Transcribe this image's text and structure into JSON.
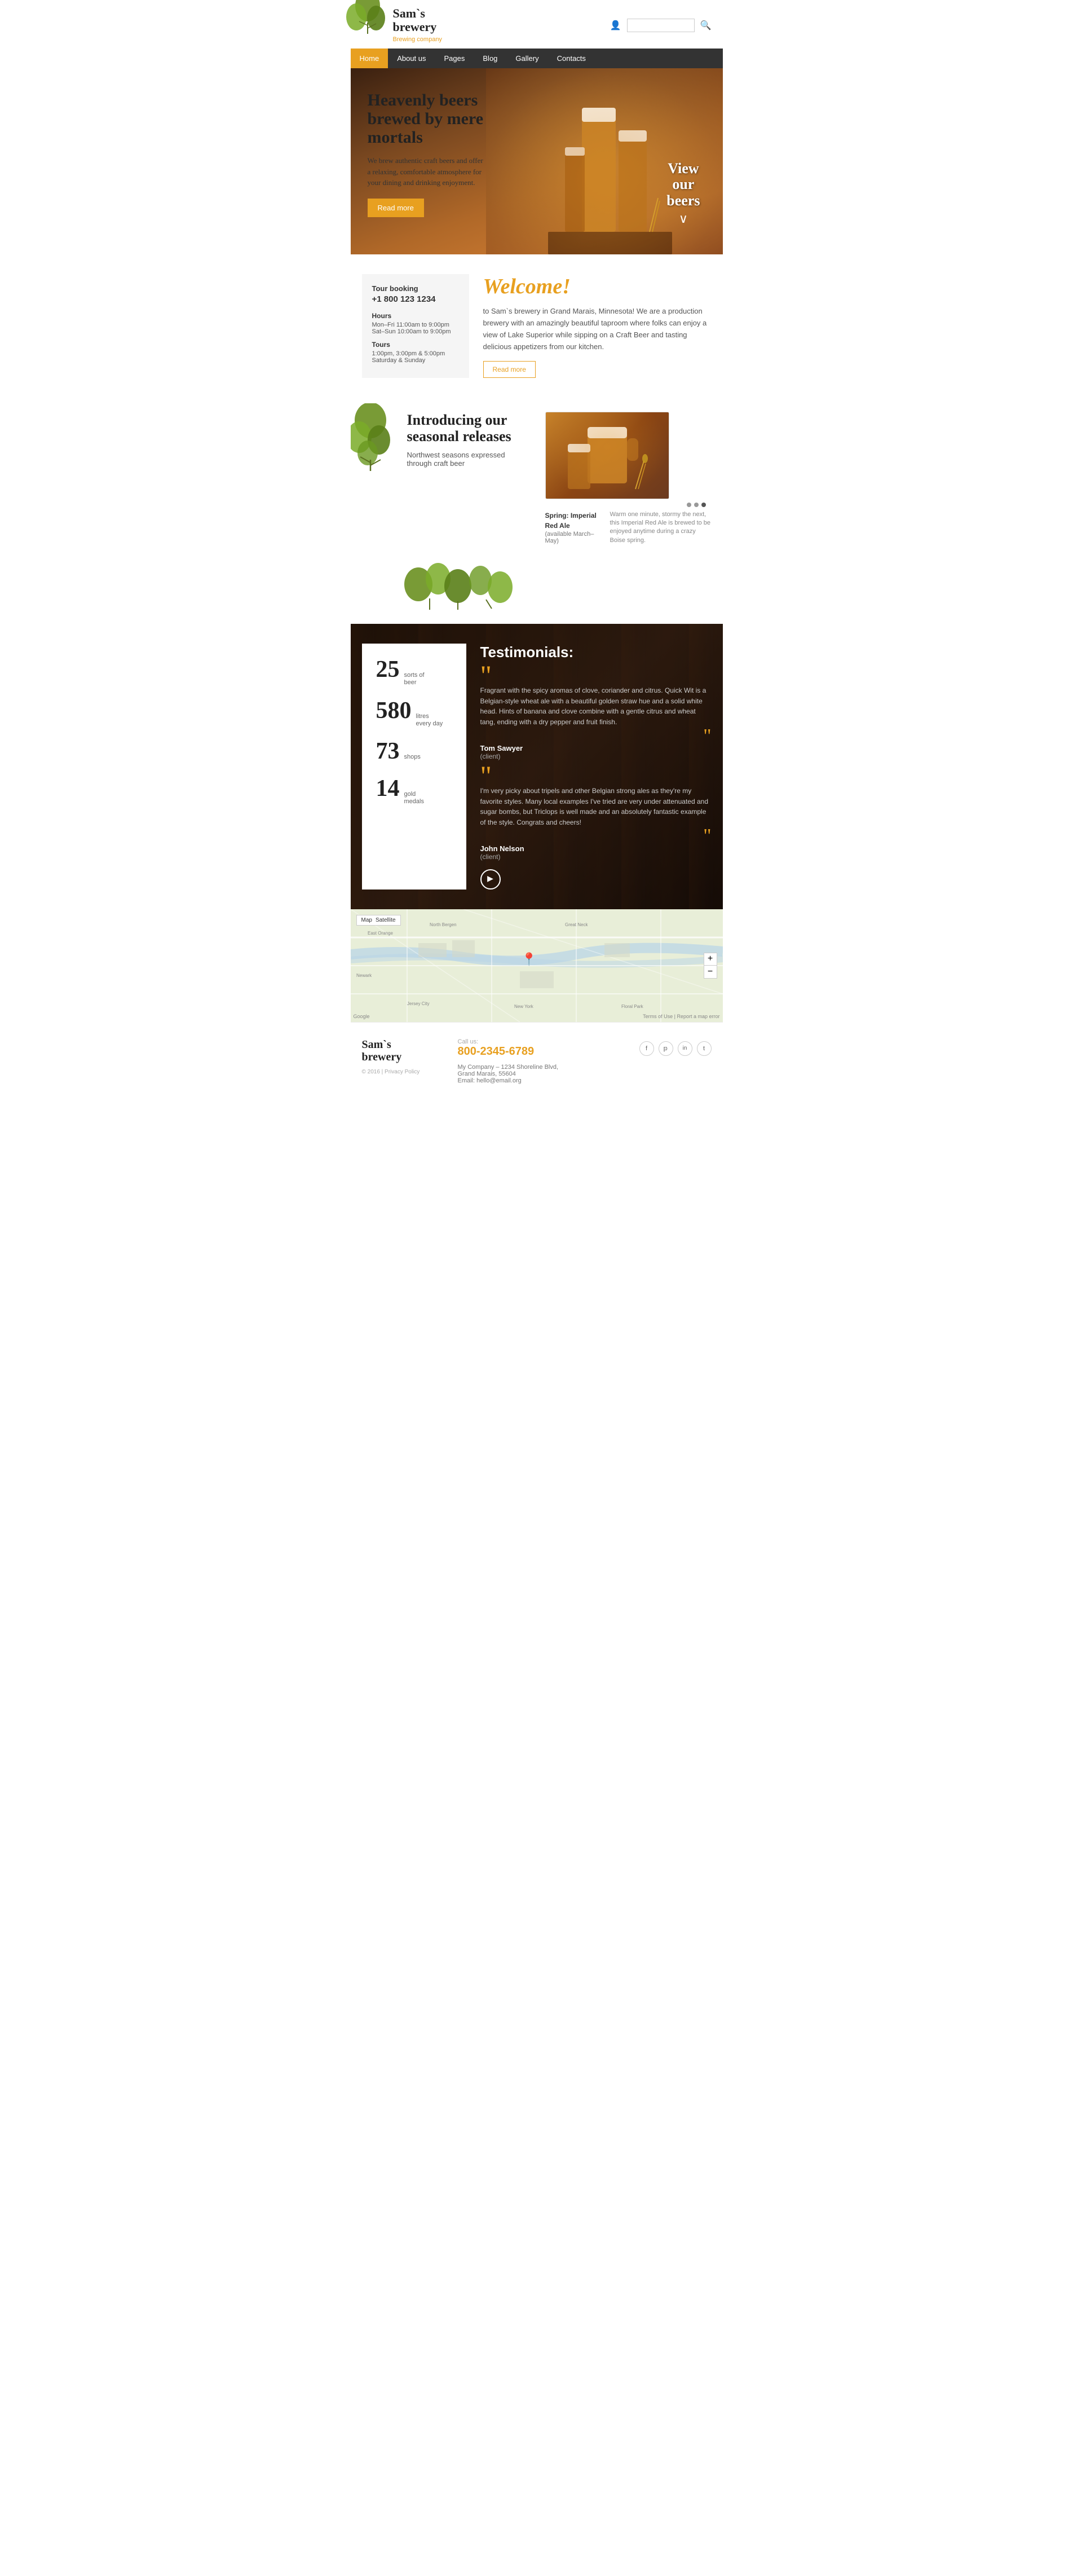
{
  "brand": {
    "name_line1": "Sam`s",
    "name_line2": "brewery",
    "tagline": "Brewing company"
  },
  "nav": {
    "items": [
      {
        "label": "Home",
        "active": true
      },
      {
        "label": "About us",
        "active": false
      },
      {
        "label": "Pages",
        "active": false
      },
      {
        "label": "Blog",
        "active": false
      },
      {
        "label": "Gallery",
        "active": false
      },
      {
        "label": "Contacts",
        "active": false
      }
    ]
  },
  "hero": {
    "title": "Heavenly beers brewed by mere mortals",
    "text": "We brew authentic craft beers and offer a relaxing, comfortable atmosphere for your dining and drinking enjoyment.",
    "cta": "Read more",
    "view_label_line1": "View",
    "view_label_line2": "our",
    "view_label_line3": "beers"
  },
  "tour": {
    "booking_label": "Tour booking",
    "phone": "+1 800 123 1234",
    "hours_label": "Hours",
    "hours_weekday": "Mon–Fri 11:00am to 9:00pm",
    "hours_weekend": "Sat–Sun 10:00am to 9:00pm",
    "tours_label": "Tours",
    "tours_times": "1:00pm, 3:00pm & 5:00pm",
    "tours_days": "Saturday & Sunday"
  },
  "welcome": {
    "title": "Welcome!",
    "text": "to Sam`s brewery in Grand Marais, Minnesota! We are a production brewery with an amazingly beautiful taproom where folks can enjoy a view of Lake Superior while sipping on a Craft Beer and tasting delicious appetizers from our kitchen.",
    "cta": "Read more"
  },
  "seasonal": {
    "title": "Introducing our seasonal releases",
    "subtitle": "Northwest seasons expressed through craft beer",
    "product_name": "Spring: Imperial Red Ale",
    "product_availability": "(available March–May)",
    "product_desc": "Warm one minute, stormy the next, this Imperial Red Ale is brewed to be enjoyed anytime during a crazy Boise spring."
  },
  "stats": [
    {
      "number": "25",
      "label_line1": "sorts of",
      "label_line2": "beer"
    },
    {
      "number": "580",
      "label_line1": "litres",
      "label_line2": "every day"
    },
    {
      "number": "73",
      "label_line1": "shops",
      "label_line2": ""
    },
    {
      "number": "14",
      "label_line1": "gold",
      "label_line2": "medals"
    }
  ],
  "testimonials": {
    "title": "Testimonials:",
    "items": [
      {
        "text": "Fragrant with the spicy aromas of clove, coriander and citrus. Quick Wit is a Belgian-style wheat ale with a beautiful golden straw hue and a solid white head. Hints of banana and clove combine with a gentle citrus and wheat tang, ending with a dry pepper and fruit finish.",
        "author": "Tom Sawyer",
        "role": "(client)"
      },
      {
        "text": "I'm very picky about tripels and other Belgian strong ales as they're my favorite styles. Many local examples I've tried are very under attenuated and sugar bombs, but Triclops is well made and an absolutely fantastic example of the style. Congrats and cheers!",
        "author": "John Nelson",
        "role": "(client)"
      }
    ]
  },
  "footer": {
    "brand_line1": "Sam`s",
    "brand_line2": "brewery",
    "copyright": "© 2016 | Privacy Policy",
    "call_label": "Call us:",
    "phone": "800-2345-6789",
    "address_label": "My Company – 1234 Shoreline Blvd,",
    "address_city": "Grand Marais, 55604",
    "email": "Email: hello@email.org",
    "social": [
      {
        "icon": "f",
        "name": "facebook"
      },
      {
        "icon": "𝕡",
        "name": "pinterest"
      },
      {
        "icon": "in",
        "name": "linkedin"
      },
      {
        "icon": "t",
        "name": "twitter"
      }
    ]
  }
}
